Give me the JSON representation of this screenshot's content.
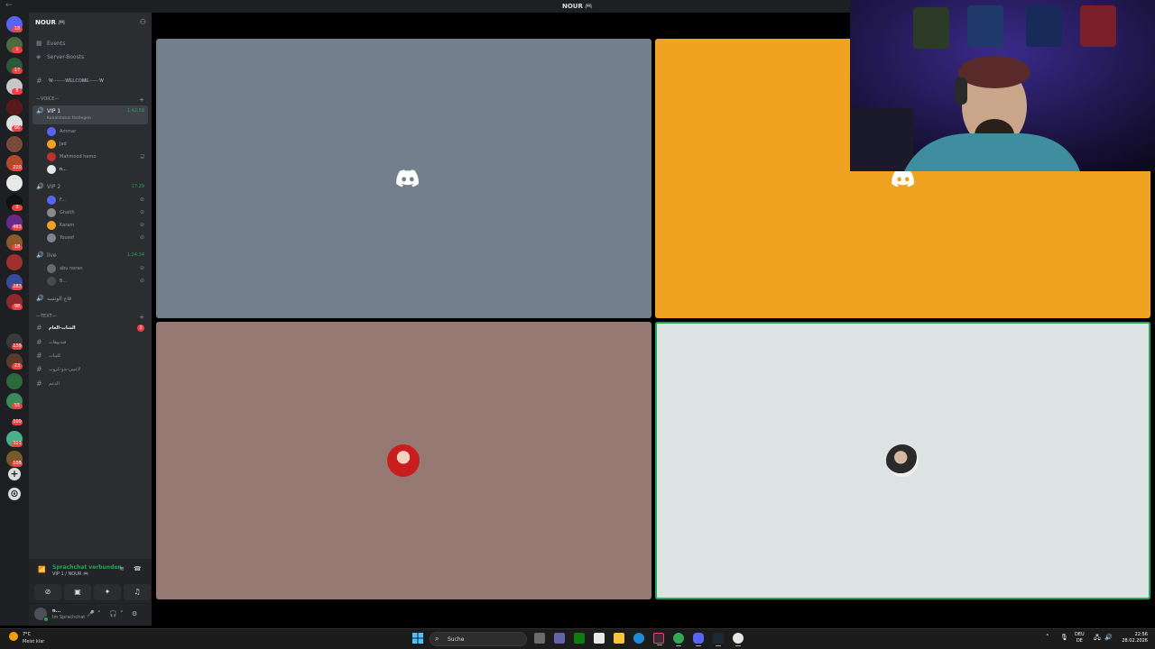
{
  "window": {
    "title": "NOUR 🎮"
  },
  "server_rail": {
    "badges": [
      "18",
      "1",
      "17",
      "8",
      "86",
      "210",
      "3",
      "483",
      "18",
      "283",
      "98",
      "139",
      "23",
      "55",
      "100",
      "321",
      "108"
    ]
  },
  "guild": {
    "name": "NOUR 🎮",
    "nav": [
      {
        "icon": "calendar-icon",
        "label": "Events"
      },
      {
        "icon": "boost-icon",
        "label": "Server-Boosts"
      }
    ],
    "welcome_channel": "𝐖·-——𝐖𝐄𝐋𝐂𝐎𝐌𝐄——·𝐖",
    "voice_category": "—VOICE—",
    "voice_channels": [
      {
        "label": "VIP 1",
        "timer": "1:42:59",
        "status": "Kanalstatus festlegen",
        "members": [
          "Ammar",
          "Jad",
          "Mahmood hemo",
          "n..."
        ]
      },
      {
        "label": "VIP 2",
        "timer": "17:29",
        "members": [
          "F...",
          "Ghaith",
          "Karam",
          "Yousef"
        ]
      },
      {
        "label": "live",
        "timer": "1:24:34",
        "members": [
          "abu noran",
          "B..."
        ]
      },
      {
        "label": "قاع الونسه",
        "timer": ""
      }
    ],
    "text_category": "—TEXT—",
    "text_channels": [
      {
        "label": "الشات-العام",
        "unread": true,
        "count": "3"
      },
      {
        "label": "فيديوهات",
        "unread": false,
        "count": ""
      },
      {
        "label": "كليبات",
        "unread": false,
        "count": ""
      },
      {
        "label": "لاعبين-بدو-كروب",
        "unread": false,
        "count": ""
      },
      {
        "label": "الدعم",
        "unread": false,
        "count": ""
      }
    ]
  },
  "voice_panel": {
    "connected": "Sprachchat verbunden",
    "location": "VIP 1 / NOUR 🎮"
  },
  "user_panel": {
    "name": "n...",
    "status": "Im Sprachchat"
  },
  "stage": {
    "tiles": [
      {
        "type": "logo",
        "color": "#747f8d"
      },
      {
        "type": "logo",
        "color": "#f0a321"
      },
      {
        "type": "avatar",
        "color": "#977974"
      },
      {
        "type": "avatar",
        "color": "#dce3e2",
        "speaking": true
      }
    ]
  },
  "taskbar": {
    "temperature": "7°C",
    "condition": "Meist klar",
    "search_placeholder": "Suche",
    "lang_top": "DEU",
    "lang_bottom": "DE",
    "time": "22:56",
    "date": "28.02.2026"
  },
  "colors": {
    "accent_green": "#23a55a",
    "badge_red": "#f23f42",
    "sidebar_bg": "#2b2d31",
    "rail_bg": "#1e1f22"
  }
}
